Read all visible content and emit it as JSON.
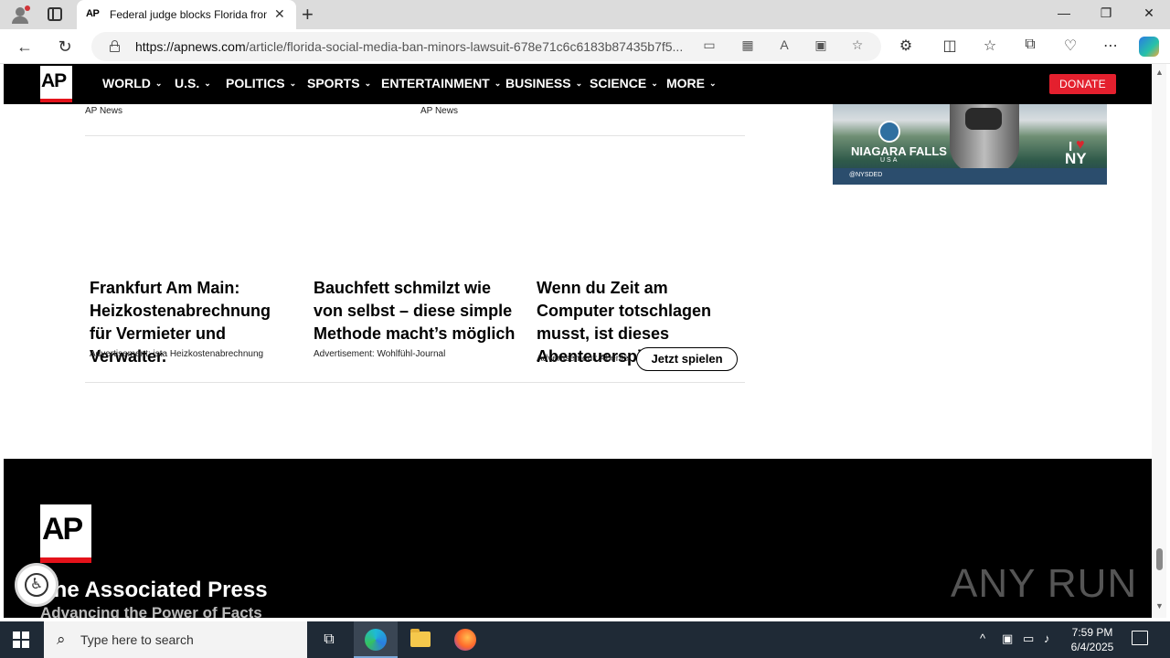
{
  "browser": {
    "tab": {
      "favicon": "AP",
      "title": "Federal judge blocks Florida from"
    },
    "url_host": "https://apnews.com",
    "url_path": "/article/florida-social-media-ban-minors-lawsuit-678e71c6c6183b87435b7f5..."
  },
  "site": {
    "logo": "AP",
    "nav": [
      "WORLD",
      "U.S.",
      "POLITICS",
      "SPORTS",
      "ENTERTAINMENT",
      "BUSINESS",
      "SCIENCE",
      "MORE"
    ],
    "donate": "DONATE"
  },
  "sources": [
    "AP News",
    "AP News"
  ],
  "ad": {
    "title": "NIAGARA FALLS",
    "subtitle": "USA",
    "i_love": "I",
    "ny": "NY",
    "credit": "@NYSDED"
  },
  "cards": [
    {
      "title": "Frankfurt Am Main: Heizkostenabrechnung für Vermieter und Verwalter.",
      "meta": "Advertisement:  ista Heizkostenabrechnung"
    },
    {
      "title": "Bauchfett schmilzt wie von selbst – diese simple Methode macht’s möglich",
      "meta": "Advertisement:  Wohlfühl-Journal"
    },
    {
      "title": "Wenn du Zeit am Computer totschlagen musst, ist dieses Abenteuerspiel ein...",
      "meta": "Advertisement:  Abente...",
      "cta": "Jetzt spielen"
    }
  ],
  "footer": {
    "logo": "AP",
    "name": "The Associated Press",
    "tagline": "Advancing the Power of Facts",
    "watermark": "ANY RUN"
  },
  "taskbar": {
    "search_placeholder": "Type here to search",
    "time": "7:59 PM",
    "date": "6/4/2025"
  }
}
